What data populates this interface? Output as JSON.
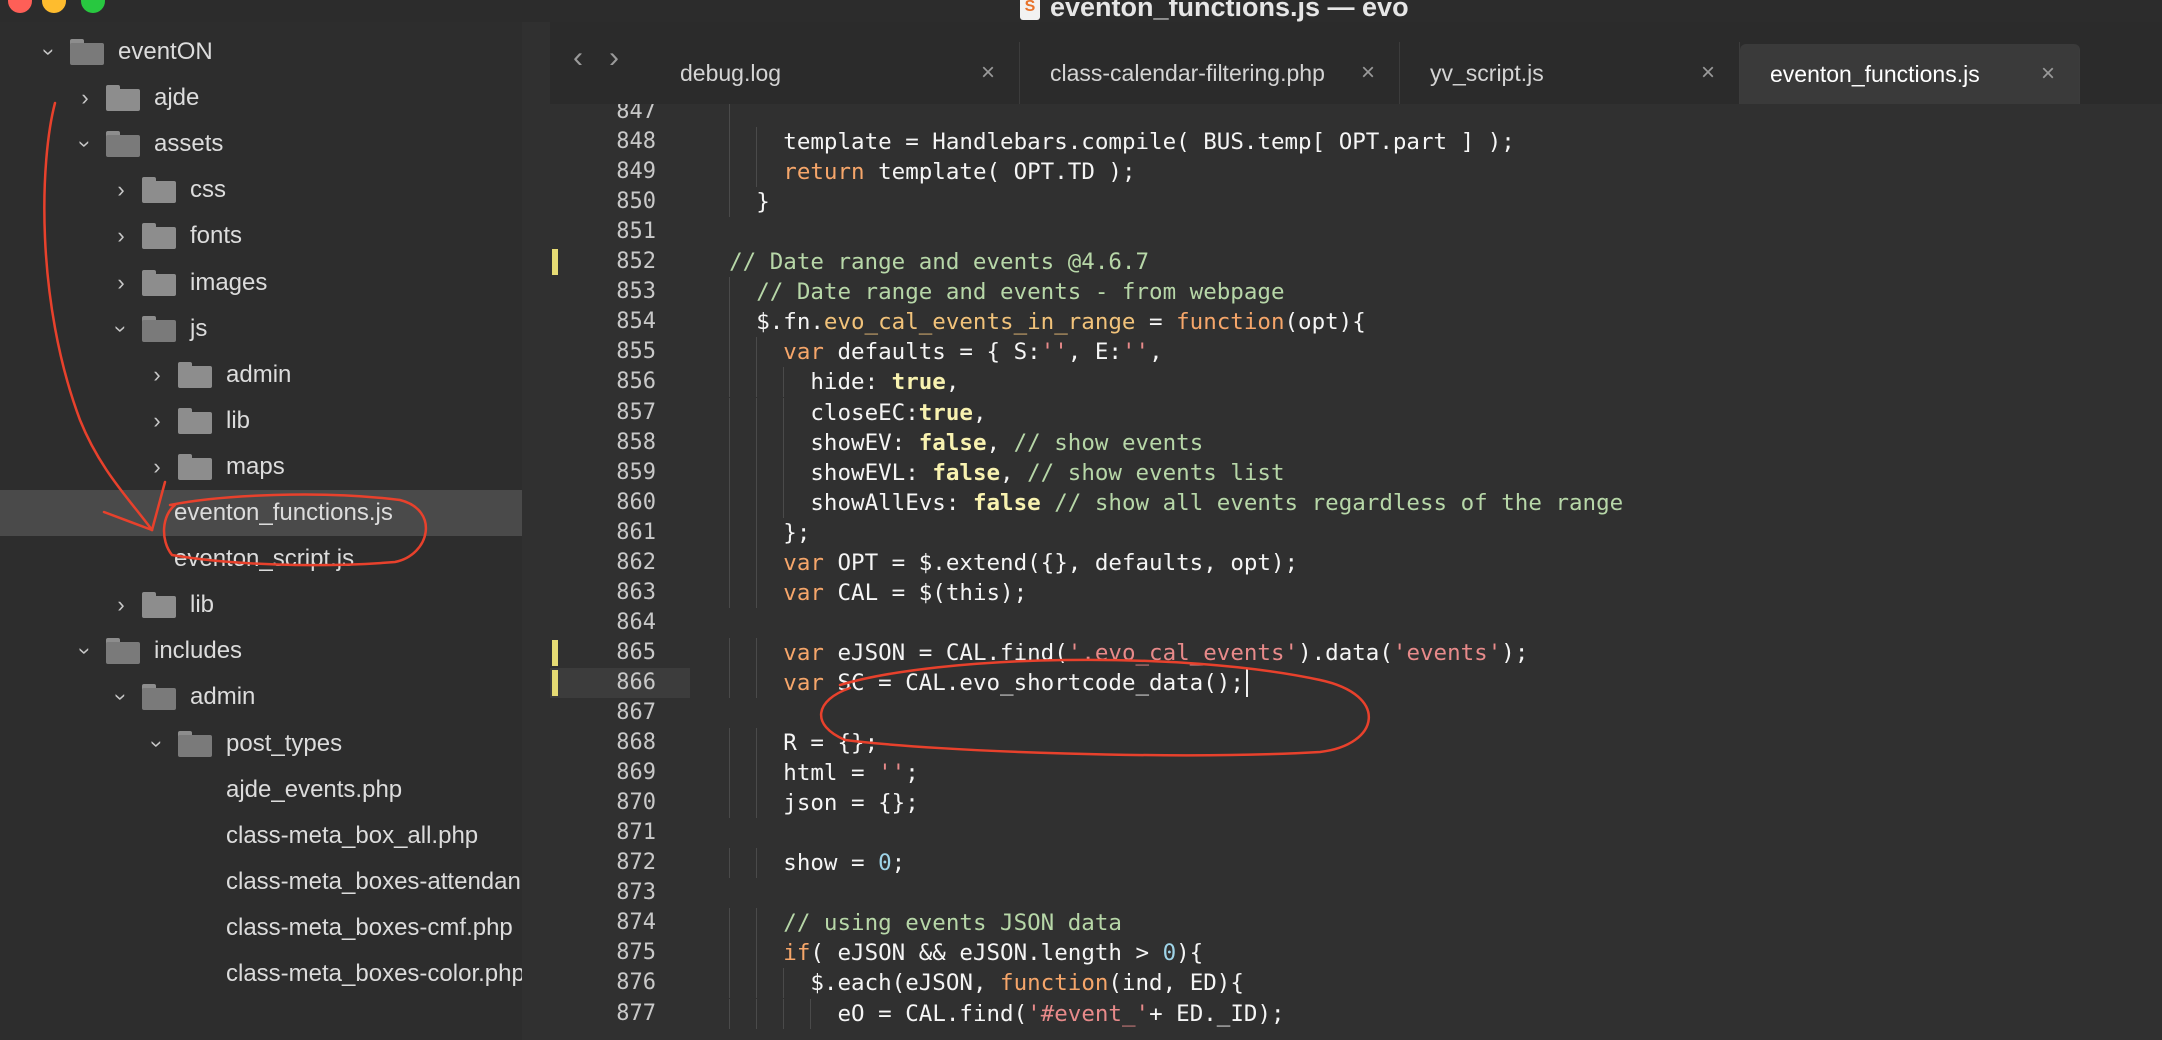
{
  "window": {
    "title": "eventon_functions.js — evo",
    "app_icon": "sublime-text-icon"
  },
  "sidebar": {
    "items": [
      {
        "label": "eventON",
        "depth": 0,
        "type": "folder",
        "expanded": true
      },
      {
        "label": "ajde",
        "depth": 1,
        "type": "folder",
        "expanded": false
      },
      {
        "label": "assets",
        "depth": 1,
        "type": "folder",
        "expanded": true
      },
      {
        "label": "css",
        "depth": 2,
        "type": "folder",
        "expanded": false
      },
      {
        "label": "fonts",
        "depth": 2,
        "type": "folder",
        "expanded": false
      },
      {
        "label": "images",
        "depth": 2,
        "type": "folder",
        "expanded": false
      },
      {
        "label": "js",
        "depth": 2,
        "type": "folder",
        "expanded": true
      },
      {
        "label": "admin",
        "depth": 3,
        "type": "folder",
        "expanded": false
      },
      {
        "label": "lib",
        "depth": 3,
        "type": "folder",
        "expanded": false
      },
      {
        "label": "maps",
        "depth": 3,
        "type": "folder",
        "expanded": false
      },
      {
        "label": "eventon_functions.js",
        "depth": 3,
        "type": "file",
        "selected": true
      },
      {
        "label": "eventon_script.js",
        "depth": 3,
        "type": "file"
      },
      {
        "label": "lib",
        "depth": 2,
        "type": "folder",
        "expanded": false
      },
      {
        "label": "includes",
        "depth": 1,
        "type": "folder",
        "expanded": true
      },
      {
        "label": "admin",
        "depth": 2,
        "type": "folder",
        "expanded": true
      },
      {
        "label": "post_types",
        "depth": 3,
        "type": "folder",
        "expanded": true
      },
      {
        "label": "ajde_events.php",
        "depth": 4,
        "type": "file"
      },
      {
        "label": "class-meta_box_all.php",
        "depth": 4,
        "type": "file"
      },
      {
        "label": "class-meta_boxes-attendan",
        "depth": 4,
        "type": "file"
      },
      {
        "label": "class-meta_boxes-cmf.php",
        "depth": 4,
        "type": "file"
      },
      {
        "label": "class-meta_boxes-color.php",
        "depth": 4,
        "type": "file"
      }
    ]
  },
  "tabs": [
    {
      "label": "debug.log",
      "active": false
    },
    {
      "label": "class-calendar-filtering.php",
      "active": false
    },
    {
      "label": "yv_script.js",
      "active": false
    },
    {
      "label": "eventon_functions.js",
      "active": true
    }
  ],
  "tab_close_glyph": "×",
  "editor": {
    "current_line": 866,
    "modified_lines": [
      852,
      865,
      866
    ],
    "lines": [
      {
        "n": "847",
        "indent": 4,
        "tokens": []
      },
      {
        "n": "848",
        "indent": 6,
        "tokens": [
          [
            "template = Handlebars.compile( BUS.temp[ OPT.part ] );",
            ""
          ]
        ]
      },
      {
        "n": "849",
        "indent": 6,
        "tokens": [
          [
            "return",
            "k"
          ],
          [
            " template( OPT.TD );",
            ""
          ]
        ]
      },
      {
        "n": "850",
        "indent": 4,
        "tokens": [
          [
            "}",
            ""
          ]
        ]
      },
      {
        "n": "851",
        "indent": 0,
        "tokens": []
      },
      {
        "n": "852",
        "indent": 2,
        "tokens": [
          [
            "// Date range and events @4.6.7",
            "c"
          ]
        ]
      },
      {
        "n": "853",
        "indent": 4,
        "tokens": [
          [
            "// Date range and events - from webpage",
            "c"
          ]
        ]
      },
      {
        "n": "854",
        "indent": 4,
        "tokens": [
          [
            "$.fn.",
            ""
          ],
          [
            "evo_cal_events_in_range",
            "f"
          ],
          [
            " = ",
            ""
          ],
          [
            "function",
            "k"
          ],
          [
            "(opt){",
            ""
          ]
        ]
      },
      {
        "n": "855",
        "indent": 6,
        "tokens": [
          [
            "var",
            "k"
          ],
          [
            " defaults = { S:",
            ""
          ],
          [
            "''",
            "s"
          ],
          [
            ", E:",
            ""
          ],
          [
            "''",
            "s"
          ],
          [
            ",",
            ""
          ]
        ]
      },
      {
        "n": "856",
        "indent": 8,
        "tokens": [
          [
            "hide: ",
            ""
          ],
          [
            "true",
            "b"
          ],
          [
            ",",
            ""
          ]
        ]
      },
      {
        "n": "857",
        "indent": 8,
        "tokens": [
          [
            "closeEC:",
            ""
          ],
          [
            "true",
            "b"
          ],
          [
            ",",
            ""
          ]
        ]
      },
      {
        "n": "858",
        "indent": 8,
        "tokens": [
          [
            "showEV: ",
            ""
          ],
          [
            "false",
            "b"
          ],
          [
            ", ",
            ""
          ],
          [
            "// show events",
            "c"
          ]
        ]
      },
      {
        "n": "859",
        "indent": 8,
        "tokens": [
          [
            "showEVL: ",
            ""
          ],
          [
            "false",
            "b"
          ],
          [
            ", ",
            ""
          ],
          [
            "// show events list",
            "c"
          ]
        ]
      },
      {
        "n": "860",
        "indent": 8,
        "tokens": [
          [
            "showAllEvs: ",
            ""
          ],
          [
            "false",
            "b"
          ],
          [
            " ",
            ""
          ],
          [
            "// show all events regardless of the range",
            "c"
          ]
        ]
      },
      {
        "n": "861",
        "indent": 6,
        "tokens": [
          [
            "};",
            ""
          ]
        ]
      },
      {
        "n": "862",
        "indent": 6,
        "tokens": [
          [
            "var",
            "k"
          ],
          [
            " OPT = $.extend({}, defaults, opt);",
            ""
          ]
        ]
      },
      {
        "n": "863",
        "indent": 6,
        "tokens": [
          [
            "var",
            "k"
          ],
          [
            " CAL = $(this);",
            ""
          ]
        ]
      },
      {
        "n": "864",
        "indent": 0,
        "tokens": []
      },
      {
        "n": "865",
        "indent": 6,
        "tokens": [
          [
            "var",
            "k"
          ],
          [
            " eJSON = CAL.find(",
            ""
          ],
          [
            "'.evo_cal_events'",
            "s"
          ],
          [
            ").data(",
            ""
          ],
          [
            "'events'",
            "s"
          ],
          [
            ");",
            ""
          ]
        ]
      },
      {
        "n": "866",
        "indent": 6,
        "tokens": [
          [
            "var",
            "k"
          ],
          [
            " SC = CAL.evo_shortcode_data();",
            ""
          ]
        ]
      },
      {
        "n": "867",
        "indent": 0,
        "tokens": []
      },
      {
        "n": "868",
        "indent": 6,
        "tokens": [
          [
            "R = {};",
            ""
          ]
        ]
      },
      {
        "n": "869",
        "indent": 6,
        "tokens": [
          [
            "html = ",
            ""
          ],
          [
            "''",
            "s"
          ],
          [
            ";",
            ""
          ]
        ]
      },
      {
        "n": "870",
        "indent": 6,
        "tokens": [
          [
            "json = {};",
            ""
          ]
        ]
      },
      {
        "n": "871",
        "indent": 0,
        "tokens": []
      },
      {
        "n": "872",
        "indent": 6,
        "tokens": [
          [
            "show = ",
            ""
          ],
          [
            "0",
            "n"
          ],
          [
            ";",
            ""
          ]
        ]
      },
      {
        "n": "873",
        "indent": 0,
        "tokens": []
      },
      {
        "n": "874",
        "indent": 6,
        "tokens": [
          [
            "// using events JSON data",
            "c"
          ]
        ]
      },
      {
        "n": "875",
        "indent": 6,
        "tokens": [
          [
            "if",
            "k"
          ],
          [
            "( eJSON && eJSON.length > ",
            ""
          ],
          [
            "0",
            "n"
          ],
          [
            "){",
            ""
          ]
        ]
      },
      {
        "n": "876",
        "indent": 8,
        "tokens": [
          [
            "$.each(eJSON, ",
            ""
          ],
          [
            "function",
            "k"
          ],
          [
            "(ind, ED){",
            ""
          ]
        ]
      },
      {
        "n": "877",
        "indent": 10,
        "tokens": [
          [
            "eO = CAL.find(",
            ""
          ],
          [
            "'#event_'",
            "s"
          ],
          [
            "+ ED._ID);",
            ""
          ]
        ]
      }
    ]
  },
  "annotation_color": "#e8412c"
}
